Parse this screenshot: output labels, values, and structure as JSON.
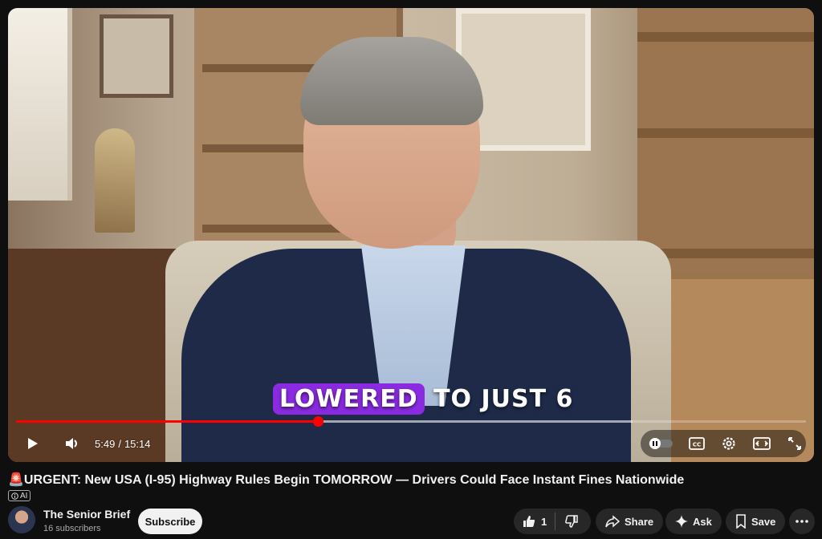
{
  "player": {
    "caption_highlight": "LOWERED",
    "caption_rest": "TO JUST 6",
    "time_current": "5:49",
    "time_total": "15:14",
    "time_separator": "/",
    "progress_played": 0.382,
    "progress_buffered": 0.78,
    "icons": [
      "play-icon",
      "volume-icon",
      "autoplay-toggle",
      "cc-icon",
      "settings-icon",
      "theater-icon",
      "fullscreen-icon"
    ]
  },
  "video": {
    "title_icon": "🚨",
    "title": "URGENT: New USA (I-95) Highway Rules Begin TOMORROW — Drivers Could Face Instant Fines Nationwide",
    "ai_label": "AI"
  },
  "channel": {
    "name": "The Senior Brief",
    "subscribers": "16 subscribers",
    "subscribe_label": "Subscribe"
  },
  "actions": {
    "like_count": "1",
    "share_label": "Share",
    "ask_label": "Ask",
    "save_label": "Save"
  },
  "colors": {
    "progress": "#ff0000",
    "caption_highlight": "#8a2be2",
    "background": "#0f0f0f",
    "pill": "#272727"
  }
}
